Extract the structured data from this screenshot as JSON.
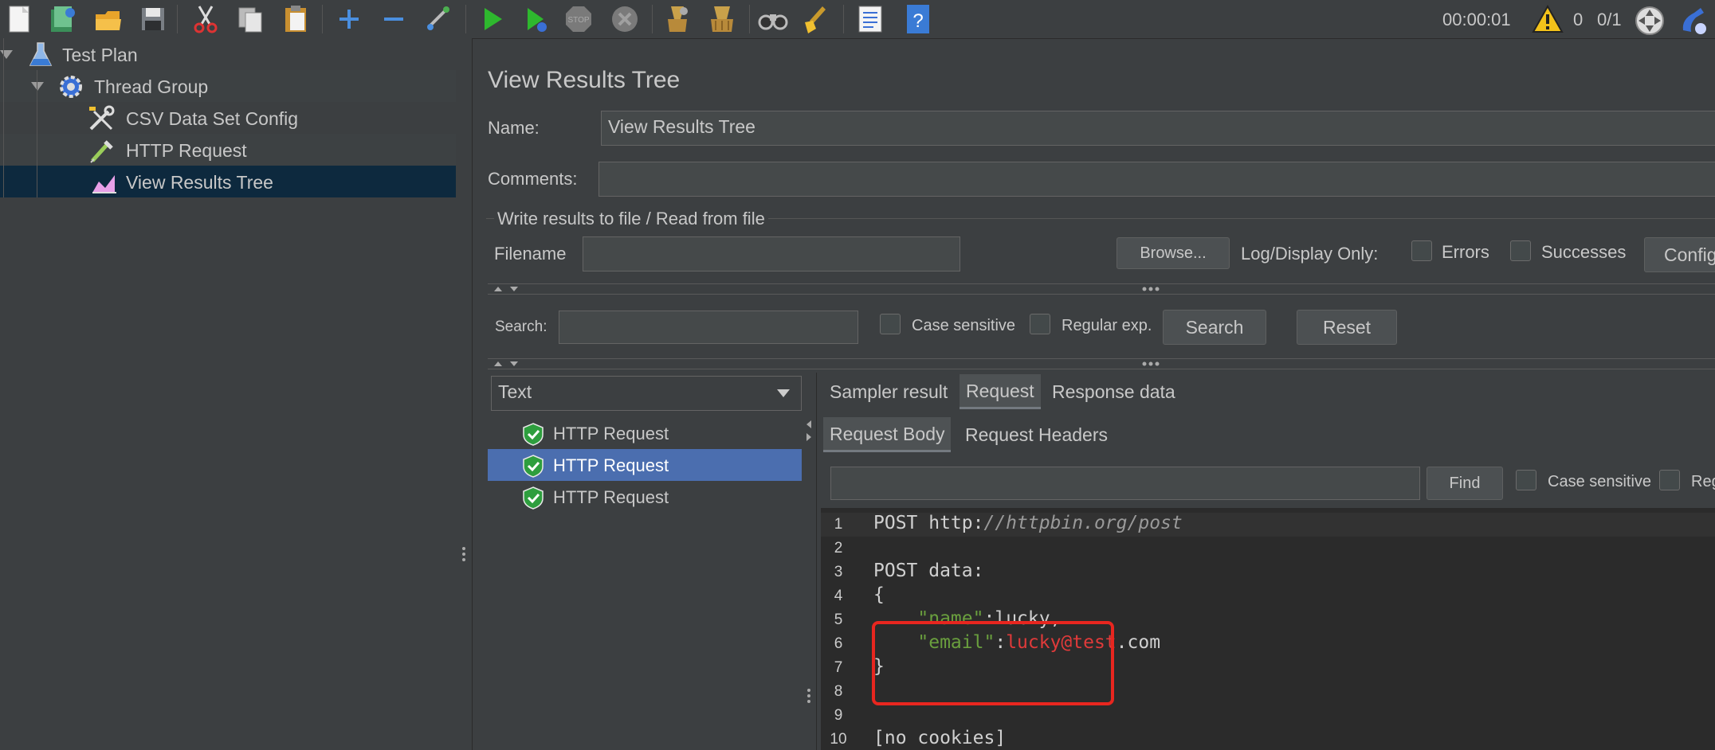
{
  "toolbar": {
    "icons": [
      "new-icon",
      "templates-icon",
      "open-icon",
      "save-icon",
      "cut-icon",
      "copy-icon",
      "paste-icon",
      "expand-icon",
      "collapse-icon",
      "toggle-icon",
      "start-icon",
      "start-no-pauses-icon",
      "stop-icon",
      "shutdown-icon",
      "clear-icon",
      "clear-all-icon",
      "search-icon",
      "reset-search-icon",
      "function-helper-icon",
      "help-icon"
    ],
    "elapsed_time": "00:00:01",
    "warning_count": "0",
    "threads": "0/1"
  },
  "tree": {
    "items": [
      {
        "label": "Test Plan"
      },
      {
        "label": "Thread Group"
      },
      {
        "label": "CSV Data Set Config"
      },
      {
        "label": "HTTP Request"
      },
      {
        "label": "View Results Tree"
      }
    ]
  },
  "panel": {
    "title": "View Results Tree",
    "name_label": "Name:",
    "name_value": "View Results Tree",
    "comments_label": "Comments:",
    "comments_value": "",
    "file_section_title": "Write results to file / Read from file",
    "filename_label": "Filename",
    "browse_label": "Browse...",
    "log_display_label": "Log/Display Only:",
    "errors_label": "Errors",
    "successes_label": "Successes",
    "configure_label": "Config"
  },
  "search": {
    "label": "Search:",
    "case_sensitive_label": "Case sensitive",
    "regex_label": "Regular exp.",
    "search_button": "Search",
    "reset_button": "Reset"
  },
  "results": {
    "renderer": "Text",
    "samples": [
      {
        "label": "HTTP Request",
        "selected": false
      },
      {
        "label": "HTTP Request",
        "selected": true
      },
      {
        "label": "HTTP Request",
        "selected": false
      }
    ],
    "tabs": [
      "Sampler result",
      "Request",
      "Response data"
    ],
    "sub_tabs": [
      "Request Body",
      "Request Headers"
    ],
    "find_button": "Find",
    "find_case_sensitive": "Case sensitive",
    "find_regex_partial": "Reg"
  },
  "code": {
    "lines": [
      {
        "n": "1",
        "text": "POST http://httpbin.org/post"
      },
      {
        "n": "2",
        "text": ""
      },
      {
        "n": "3",
        "text": "POST data:"
      },
      {
        "n": "4",
        "text": "{"
      },
      {
        "n": "5",
        "key": "\"name\"",
        "sep": ":",
        "val": "lucky,"
      },
      {
        "n": "6",
        "key": "\"email\"",
        "sep": ":",
        "val_red": "lucky@test",
        "val": ".com"
      },
      {
        "n": "7",
        "text": "}"
      },
      {
        "n": "8",
        "text": ""
      },
      {
        "n": "9",
        "text": ""
      },
      {
        "n": "10",
        "text": "[no cookies]"
      }
    ],
    "line1_method": "POST http:",
    "line1_url": "//httpbin.org/post",
    "highlight_color": "#e8261f"
  }
}
